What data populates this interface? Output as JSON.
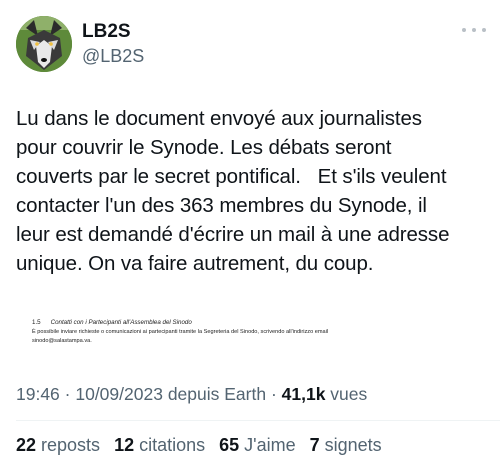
{
  "author": {
    "display_name": "LB2S",
    "handle": "@LB2S",
    "avatar_icon": "wolf-avatar-icon",
    "avatar_bg": "#5e8a3a"
  },
  "menu": {
    "more_icon": "more-horizontal-icon"
  },
  "tweet": {
    "text": "Lu dans le document envoyé aux journalistes\npour couvrir le Synode. Les débats seront\ncouverts par le secret pontifical.   Et s'ils veulent\ncontacter l'un des 363 membres du Synode, il\nleur est demandé d'écrire un mail à une adresse\nunique. On va faire autrement, du coup."
  },
  "attached_document": {
    "section_number": "1.5",
    "section_title": "Contatti con i Partecipanti all'Assemblea del Sinodo",
    "body_line_1": "È possibile inviare richieste o comunicazioni ai partecipanti tramite la Segreteria del Sinodo, scrivendo all'indirizzo email",
    "body_line_2": "sinodo@salastampa.va."
  },
  "meta": {
    "time": "19:46",
    "separator_1": " · ",
    "date": "10/09/2023",
    "source": " depuis Earth",
    "separator_2": " · ",
    "views_count": "41,1k",
    "views_label": " vues"
  },
  "stats": [
    {
      "count": "22",
      "label": "reposts"
    },
    {
      "count": "12",
      "label": "citations"
    },
    {
      "count": "65",
      "label": "J'aime"
    },
    {
      "count": "7",
      "label": "signets"
    }
  ],
  "colors": {
    "text_primary": "#0f1419",
    "text_secondary": "#536471",
    "divider": "#eff3f4"
  }
}
